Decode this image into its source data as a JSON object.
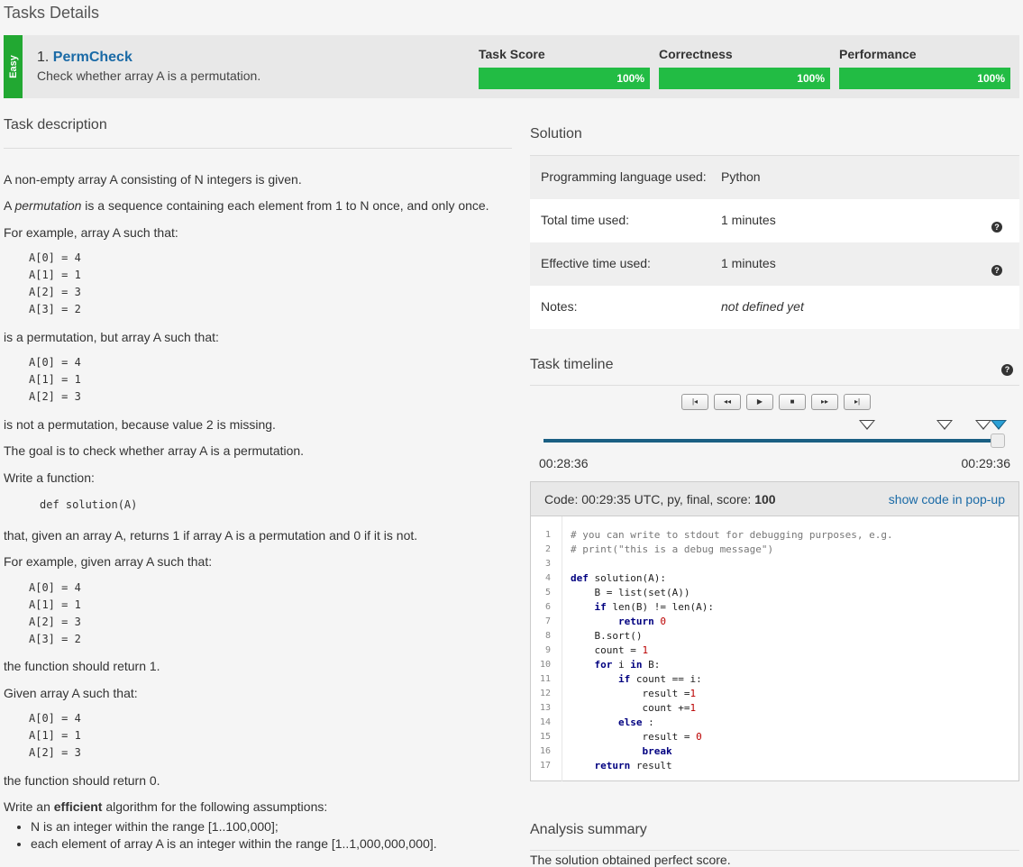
{
  "page_title": "Tasks Details",
  "task": {
    "difficulty": "Easy",
    "number": "1.",
    "name": "PermCheck",
    "subtitle": "Check whether array A is a permutation.",
    "scores": [
      {
        "label": "Task Score",
        "value": "100%",
        "fraction": 1.0
      },
      {
        "label": "Correctness",
        "value": "100%",
        "fraction": 1.0
      },
      {
        "label": "Performance",
        "value": "100%",
        "fraction": 1.0
      }
    ]
  },
  "description": {
    "title": "Task description",
    "p1": "A non-empty array A consisting of N integers is given.",
    "p2_pre": "A ",
    "p2_em": "permutation",
    "p2_post": " is a sequence containing each element from 1 to N once, and only once.",
    "p3": "For example, array A such that:",
    "ex1": "A[0] = 4\nA[1] = 1\nA[2] = 3\nA[3] = 2",
    "p4": "is a permutation, but array A such that:",
    "ex2": "A[0] = 4\nA[1] = 1\nA[2] = 3",
    "p5": "is not a permutation, because value 2 is missing.",
    "p6": "The goal is to check whether array A is a permutation.",
    "p7": "Write a function:",
    "signature": "def solution(A)",
    "p8": "that, given an array A, returns 1 if array A is a permutation and 0 if it is not.",
    "p9": "For example, given array A such that:",
    "ex3": "A[0] = 4\nA[1] = 1\nA[2] = 3\nA[3] = 2",
    "p10": "the function should return 1.",
    "p11": "Given array A such that:",
    "ex4": "A[0] = 4\nA[1] = 1\nA[2] = 3",
    "p12": "the function should return 0.",
    "p13_pre": "Write an ",
    "p13_bold": "efficient",
    "p13_post": " algorithm for the following assumptions:",
    "assumptions": [
      "N is an integer within the range [1..100,000];",
      "each element of array A is an integer within the range [1..1,000,000,000]."
    ]
  },
  "solution": {
    "title": "Solution",
    "rows": [
      {
        "key": "Programming language used:",
        "value": "Python",
        "help": false
      },
      {
        "key": "Total time used:",
        "value": "1 minutes",
        "help": true
      },
      {
        "key": "Effective time used:",
        "value": "1 minutes",
        "help": true
      },
      {
        "key": "Notes:",
        "value": "not defined yet",
        "help": false
      }
    ]
  },
  "timeline": {
    "title": "Task timeline",
    "start": "00:28:36",
    "end": "00:29:36",
    "controls": [
      "first",
      "rewind",
      "play",
      "stop",
      "fast-forward",
      "last"
    ],
    "control_glyphs": [
      "|◂",
      "◂◂",
      "▶",
      "■",
      "▸▸",
      "▸|"
    ]
  },
  "code": {
    "info_prefix": "Code: 00:29:35 UTC, py, final, score: ",
    "score": "100",
    "popup_link": "show code in pop-up",
    "lines": [
      "# you can write to stdout for debugging purposes, e.g.",
      "# print(\"this is a debug message\")",
      "",
      "def solution(A):",
      "    B = list(set(A))",
      "    if len(B) != len(A):",
      "        return 0",
      "    B.sort()",
      "    count = 1",
      "    for i in B:",
      "        if count == i:",
      "            result =1",
      "            count +=1",
      "        else :",
      "            result = 0",
      "            break",
      "    return result"
    ]
  },
  "analysis": {
    "title": "Analysis summary",
    "text": "The solution obtained perfect score."
  },
  "colors": {
    "easy_badge": "#22a832",
    "score_bar": "#22bc44",
    "link": "#1a6aa6",
    "timeline_track": "#1a5f83"
  }
}
